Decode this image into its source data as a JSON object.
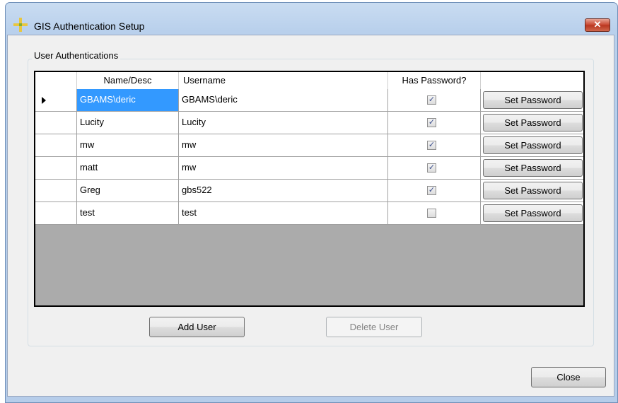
{
  "window": {
    "title": "GIS Authentication Setup",
    "close_label": "✕"
  },
  "group": {
    "label": "User Authentications"
  },
  "grid": {
    "columns": [
      "Name/Desc",
      "Username",
      "Has Password?",
      ""
    ],
    "rows": [
      {
        "name": "GBAMS\\deric",
        "username": "GBAMS\\deric",
        "has_password": true,
        "button": "Set Password"
      },
      {
        "name": "Lucity",
        "username": "Lucity",
        "has_password": true,
        "button": "Set Password"
      },
      {
        "name": "mw",
        "username": "mw",
        "has_password": true,
        "button": "Set Password"
      },
      {
        "name": "matt",
        "username": "mw",
        "has_password": true,
        "button": "Set Password"
      },
      {
        "name": "Greg",
        "username": "gbs522",
        "has_password": true,
        "button": "Set Password"
      },
      {
        "name": "test",
        "username": "test",
        "has_password": false,
        "button": "Set Password"
      }
    ],
    "selected_row": 0
  },
  "buttons": {
    "add_user": "Add User",
    "delete_user": "Delete User",
    "close": "Close"
  },
  "colors": {
    "selection": "#3399ff",
    "grid_background": "#ababab",
    "close_button": "#c7442d"
  }
}
